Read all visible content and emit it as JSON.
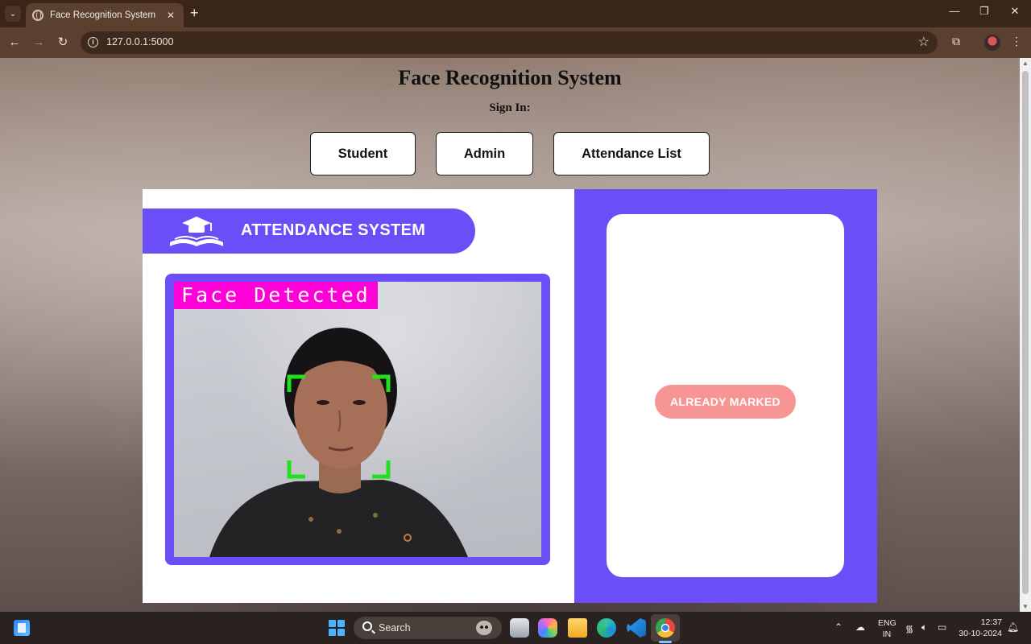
{
  "browser": {
    "tab_title": "Face Recognition System",
    "tab_close": "✕",
    "new_tab": "+",
    "url": "127.0.0.1:5000",
    "window_controls": {
      "minimize": "—",
      "restore": "❐",
      "close": "✕"
    }
  },
  "page": {
    "title": "Face Recognition System",
    "sign_in_label": "Sign In:",
    "buttons": {
      "student": "Student",
      "admin": "Admin",
      "attendance_list": "Attendance List"
    }
  },
  "card": {
    "banner_title": "ATTENDANCE SYSTEM",
    "camera": {
      "overlay_label": "Face Detected"
    },
    "result": {
      "status": "ALREADY MARKED",
      "status_color": "#f79494"
    }
  },
  "taskbar": {
    "search_label": "Search",
    "language": "ENG",
    "region": "IN",
    "time": "12:37",
    "date": "30-10-2024"
  },
  "colors": {
    "accent": "#6b4ef7",
    "face_box": "#22e01c",
    "overlay_label_bg": "#ff00d9"
  }
}
